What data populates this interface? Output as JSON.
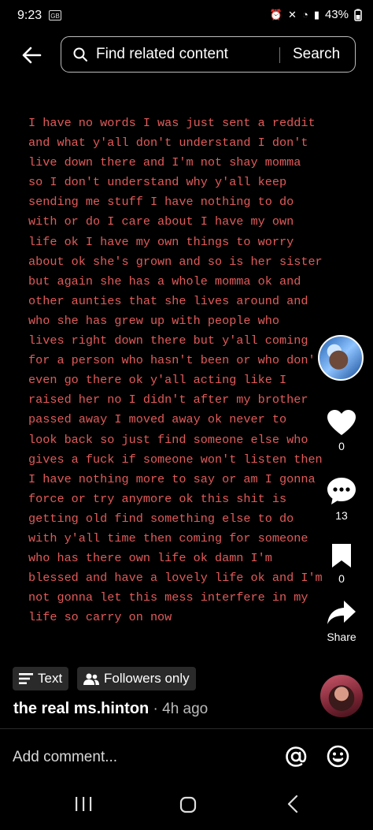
{
  "status_bar": {
    "time": "9:23",
    "sim_label": "GB",
    "battery": "43%"
  },
  "search": {
    "placeholder": "Find related content",
    "button": "Search"
  },
  "post": {
    "text": "I have no words I was just sent a reddit\nand what y'all don't understand I don't\nlive down there and I'm not shay momma\nso I don't understand why y'all keep\nsending me stuff I have nothing to do\nwith or do I care about I have my own\nlife ok I have my own things to worry\nabout ok she's grown and so is her sister\nbut again she has a whole momma ok and\nother aunties that she lives around and\nwho she has grew up with people who\nlives right down there but y'all coming\nfor a person who hasn't been or who don'\neven go there ok y'all acting like I\nraised her no I didn't after my brother\npassed away I moved away ok never to\nlook back so just find someone else who\ngives a fuck if someone won't listen then\nI have nothing more to say or am I gonna\nforce or try anymore ok this shit is\ngetting old find something else to do\nwith y'all time then coming for someone\nwho has there own life ok damn I'm\nblessed and have a lovely life ok and I'm\nnot gonna let this mess interfere in my\nlife so carry on now"
  },
  "actions": {
    "likes": "0",
    "comments": "13",
    "saves": "0",
    "share_label": "Share"
  },
  "tags": {
    "text_label": "Text",
    "followers_label": "Followers only"
  },
  "author": {
    "name": "the real ms.hinton",
    "time": " · 4h ago"
  },
  "comment": {
    "placeholder": "Add comment..."
  },
  "colors": {
    "post_text": "#e25a5a",
    "background": "#000000",
    "pill_bg": "#2a2a2a"
  }
}
